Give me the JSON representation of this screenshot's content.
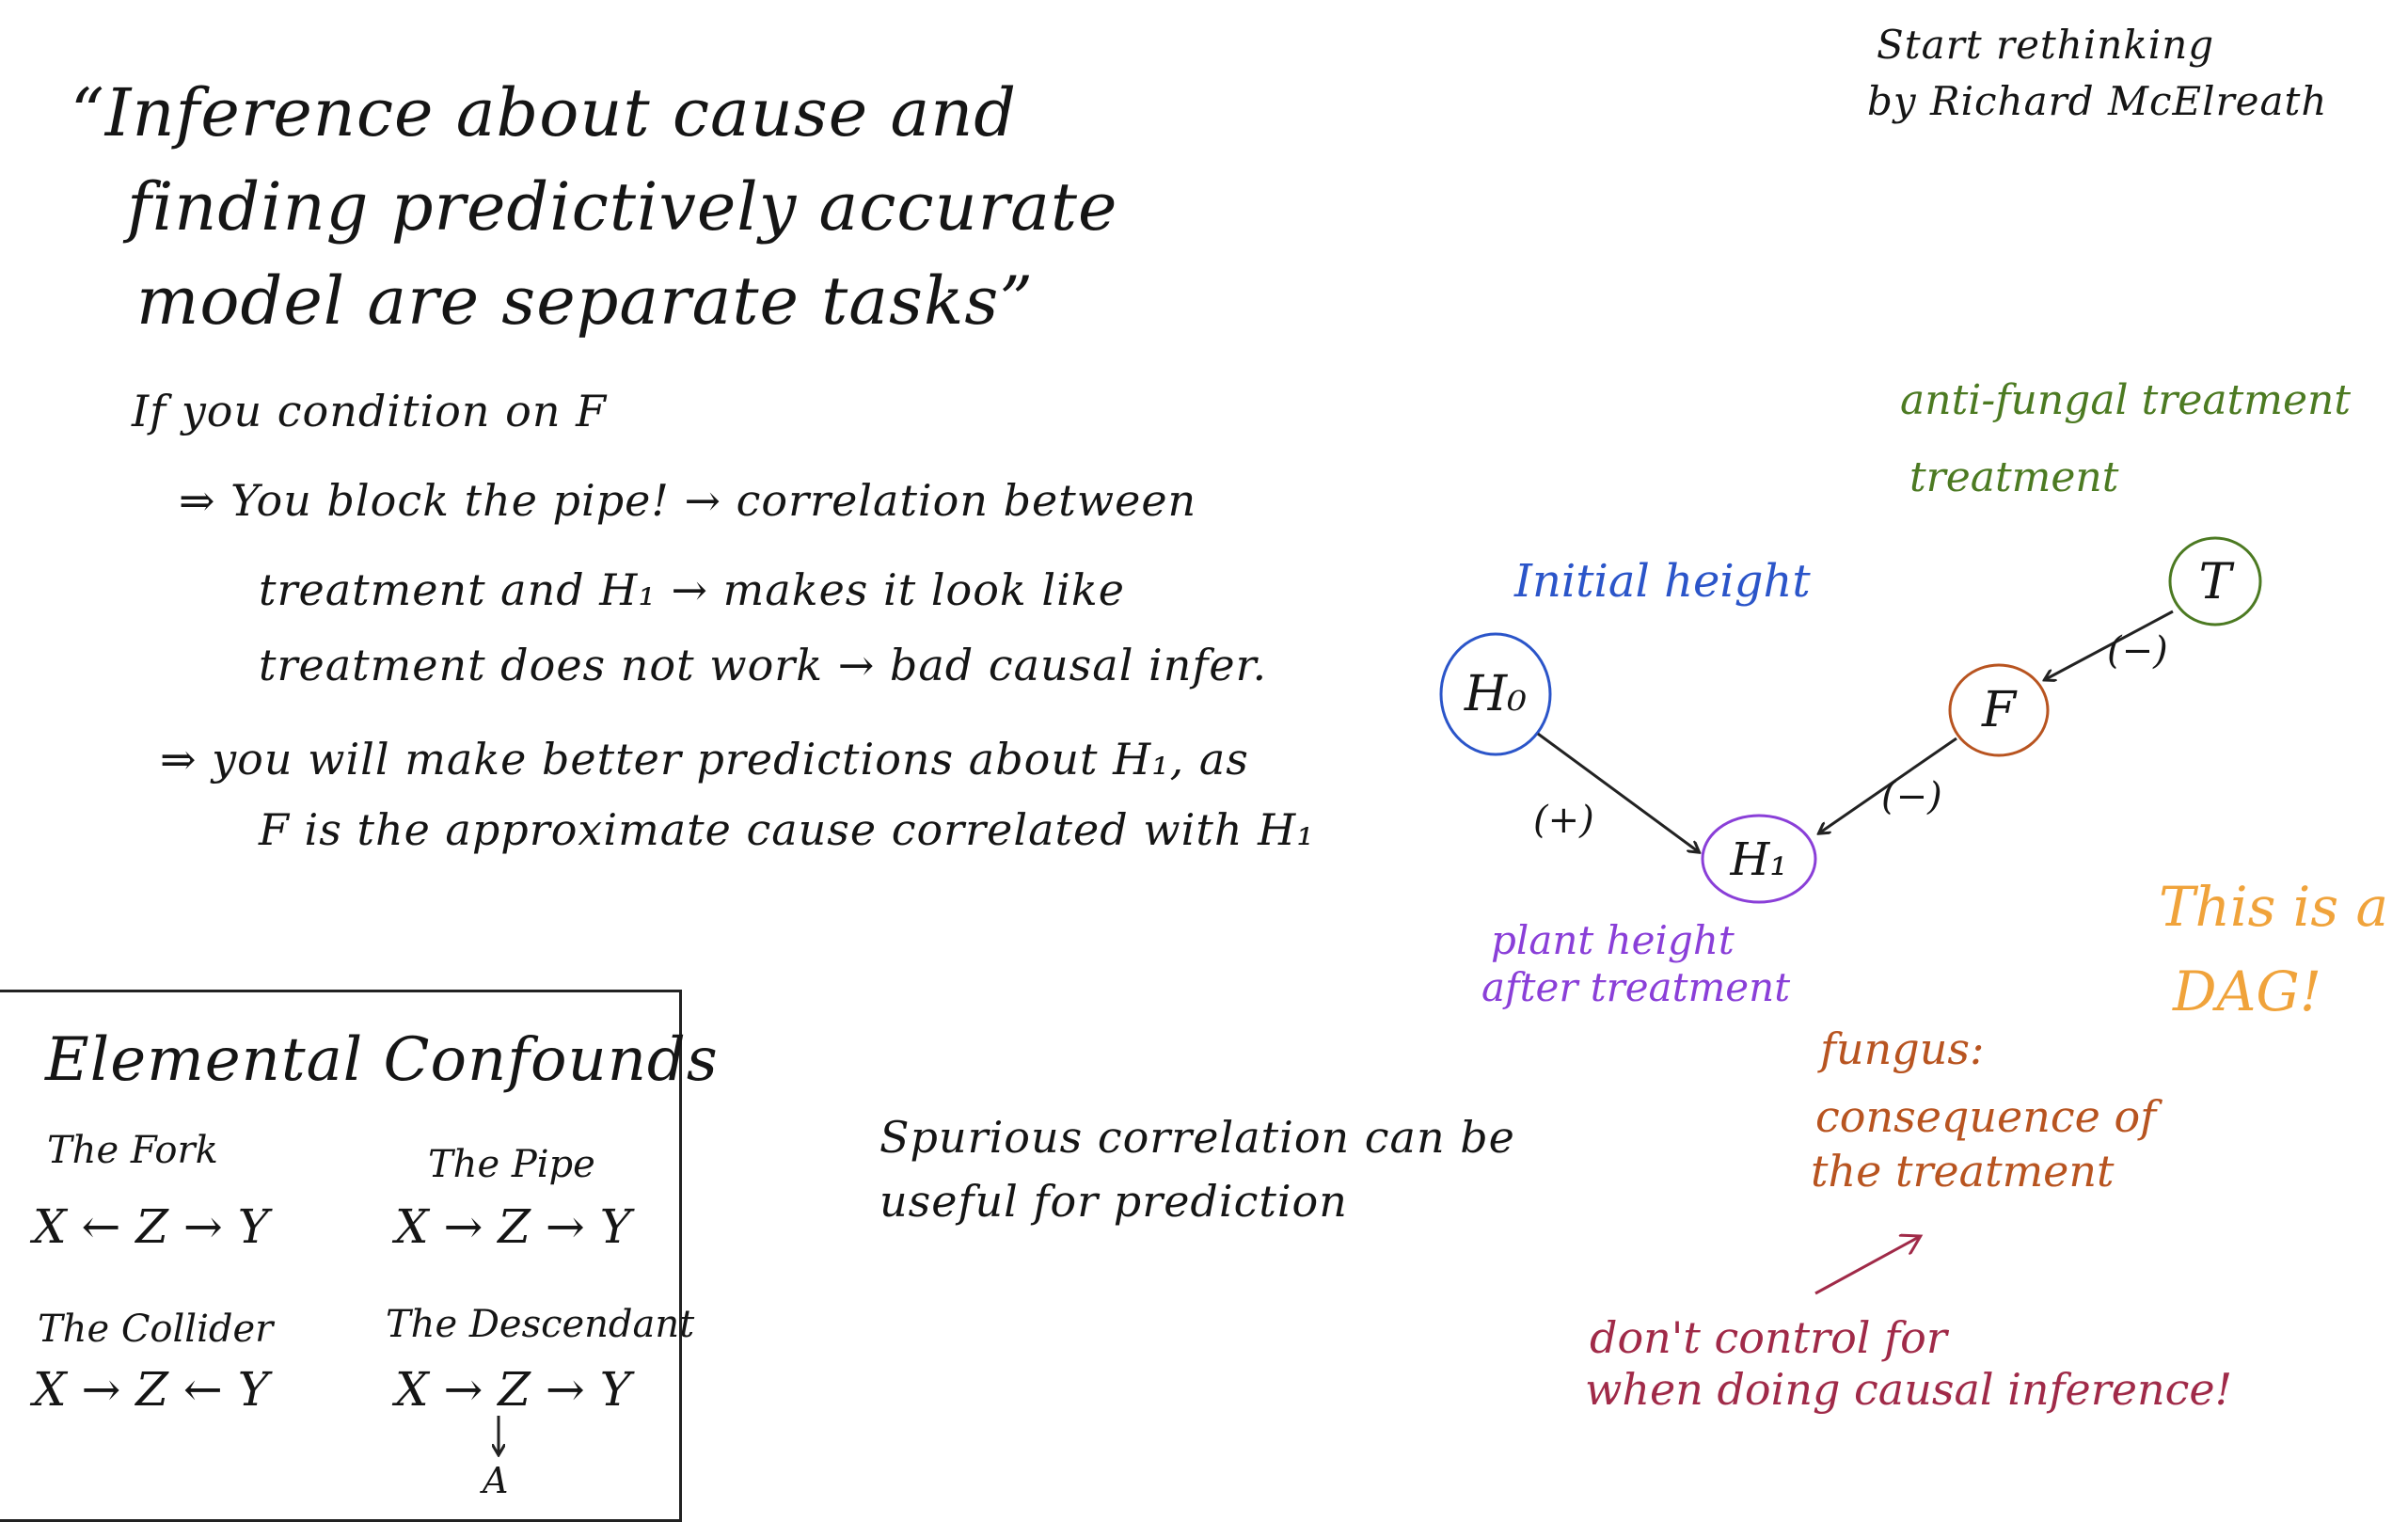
{
  "quote": {
    "line1": "“Inference about cause and",
    "line2": "finding predictively accurate",
    "line3": "model are separate tasks”"
  },
  "book": {
    "line1": "Start rethinking",
    "line2": "by Richard McElreath"
  },
  "condition": {
    "intro": "If you condition on F",
    "bullet1_line1": "⇒ You block the pipe! → correlation between",
    "bullet1_line2": "treatment and H₁ → makes it look like",
    "bullet1_line3": "treatment does not work → bad causal infer.",
    "bullet2_line1": "⇒ you will make better predictions about H₁, as",
    "bullet2_line2": "F is the approximate cause correlated with H₁"
  },
  "confounds": {
    "title": "Elemental Confounds",
    "fork_name": "The Fork",
    "fork_formula": "X ← Z → Y",
    "pipe_name": "The Pipe",
    "pipe_formula": "X → Z → Y",
    "collider_name": "The Collider",
    "collider_formula": "X → Z ← Y",
    "descendant_name": "The Descendant",
    "descendant_formula": "X → Z → Y",
    "descendant_child": "A"
  },
  "spurious": {
    "line1": "Spurious correlation can be",
    "line2": "useful for prediction"
  },
  "dag": {
    "node_h0": "H₀",
    "node_h1": "H₁",
    "node_f": "F",
    "node_t": "T",
    "sign_h0_h1": "(+)",
    "sign_f_h1": "(−)",
    "sign_t_f": "(−)",
    "label_initial_height": "Initial height",
    "label_treatment_line1": "anti-fungal treatment",
    "label_treatment_line2": "treatment",
    "label_plant_line1": "plant height",
    "label_plant_line2": "after treatment",
    "label_fungus_line1": "fungus:",
    "label_fungus_line2": "consequence of",
    "label_fungus_line3": "the treatment",
    "dag_note_line1": "This is a",
    "dag_note_line2": "DAG!",
    "control_line1": "don't control for",
    "control_line2": "when doing causal inference!"
  },
  "colors": {
    "blue": "#2b55c9",
    "green": "#4c7a22",
    "purple": "#8a3fd8",
    "brown": "#b85420",
    "orange": "#f0a33b",
    "maroon": "#a02a48"
  }
}
